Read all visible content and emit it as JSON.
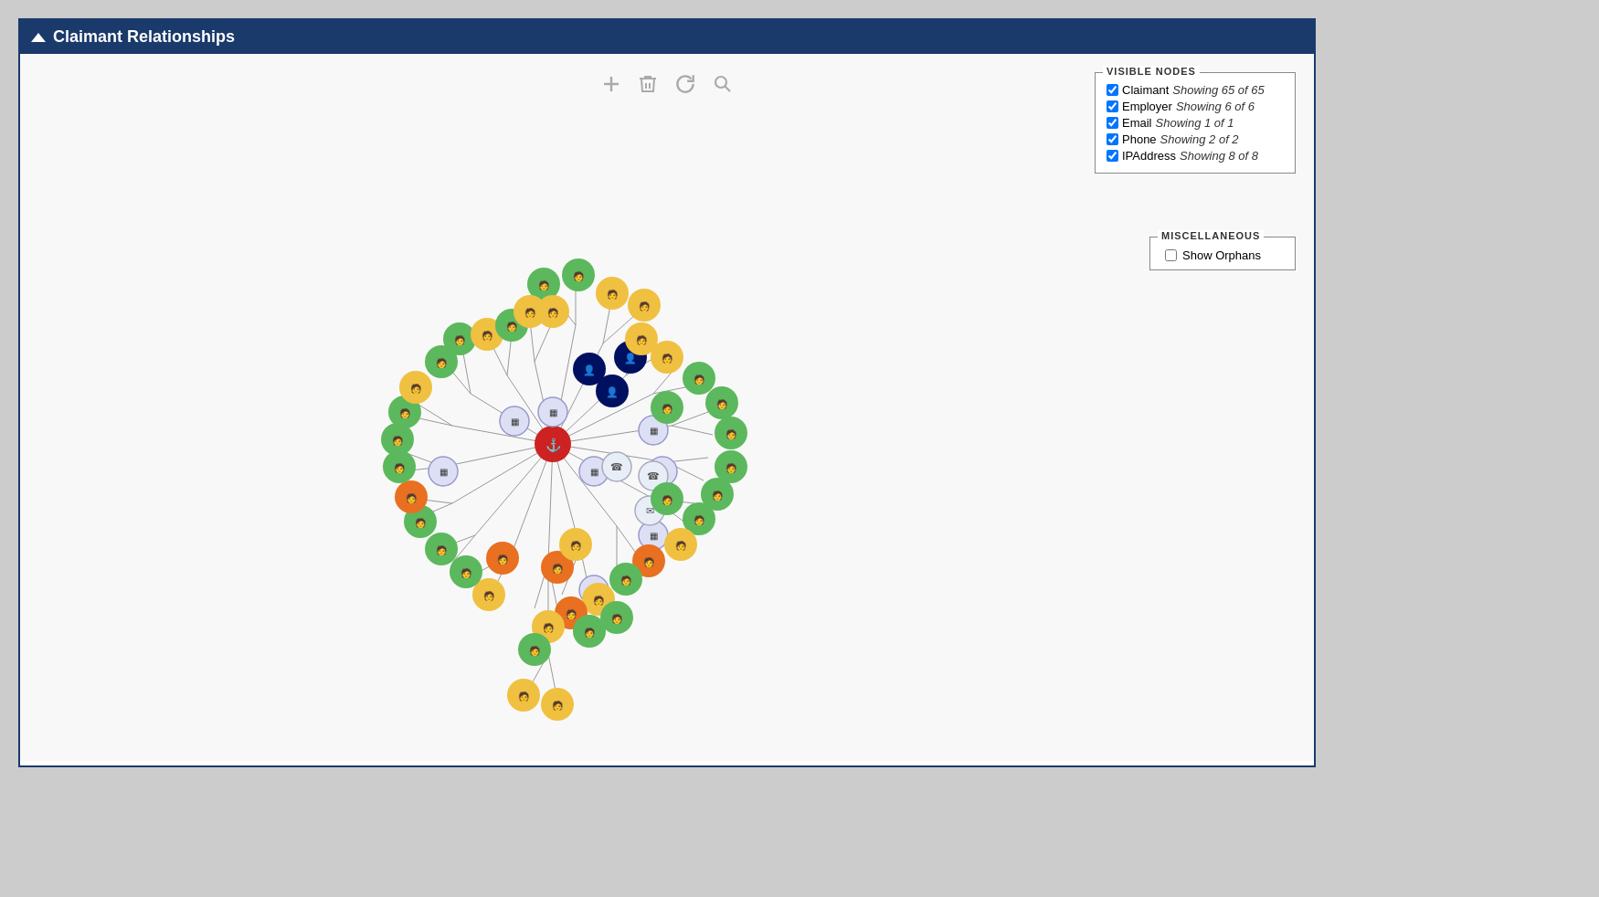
{
  "title": "Claimant Relationships",
  "toolbar": {
    "add_label": "+",
    "delete_label": "🗑",
    "refresh_label": "↻",
    "search_label": "🔍"
  },
  "visible_nodes": {
    "panel_title": "VISIBLE NODES",
    "items": [
      {
        "label": "Claimant",
        "count": "Showing 65 of 65",
        "checked": true
      },
      {
        "label": "Employer",
        "count": "Showing 6 of 6",
        "checked": true
      },
      {
        "label": "Email",
        "count": "Showing 1 of 1",
        "checked": true
      },
      {
        "label": "Phone",
        "count": "Showing 2 of 2",
        "checked": true
      },
      {
        "label": "IPAddress",
        "count": "Showing 8 of 8",
        "checked": true
      }
    ]
  },
  "miscellaneous": {
    "panel_title": "MISCELLANEOUS",
    "show_orphans_label": "Show Orphans",
    "show_orphans_checked": false
  }
}
